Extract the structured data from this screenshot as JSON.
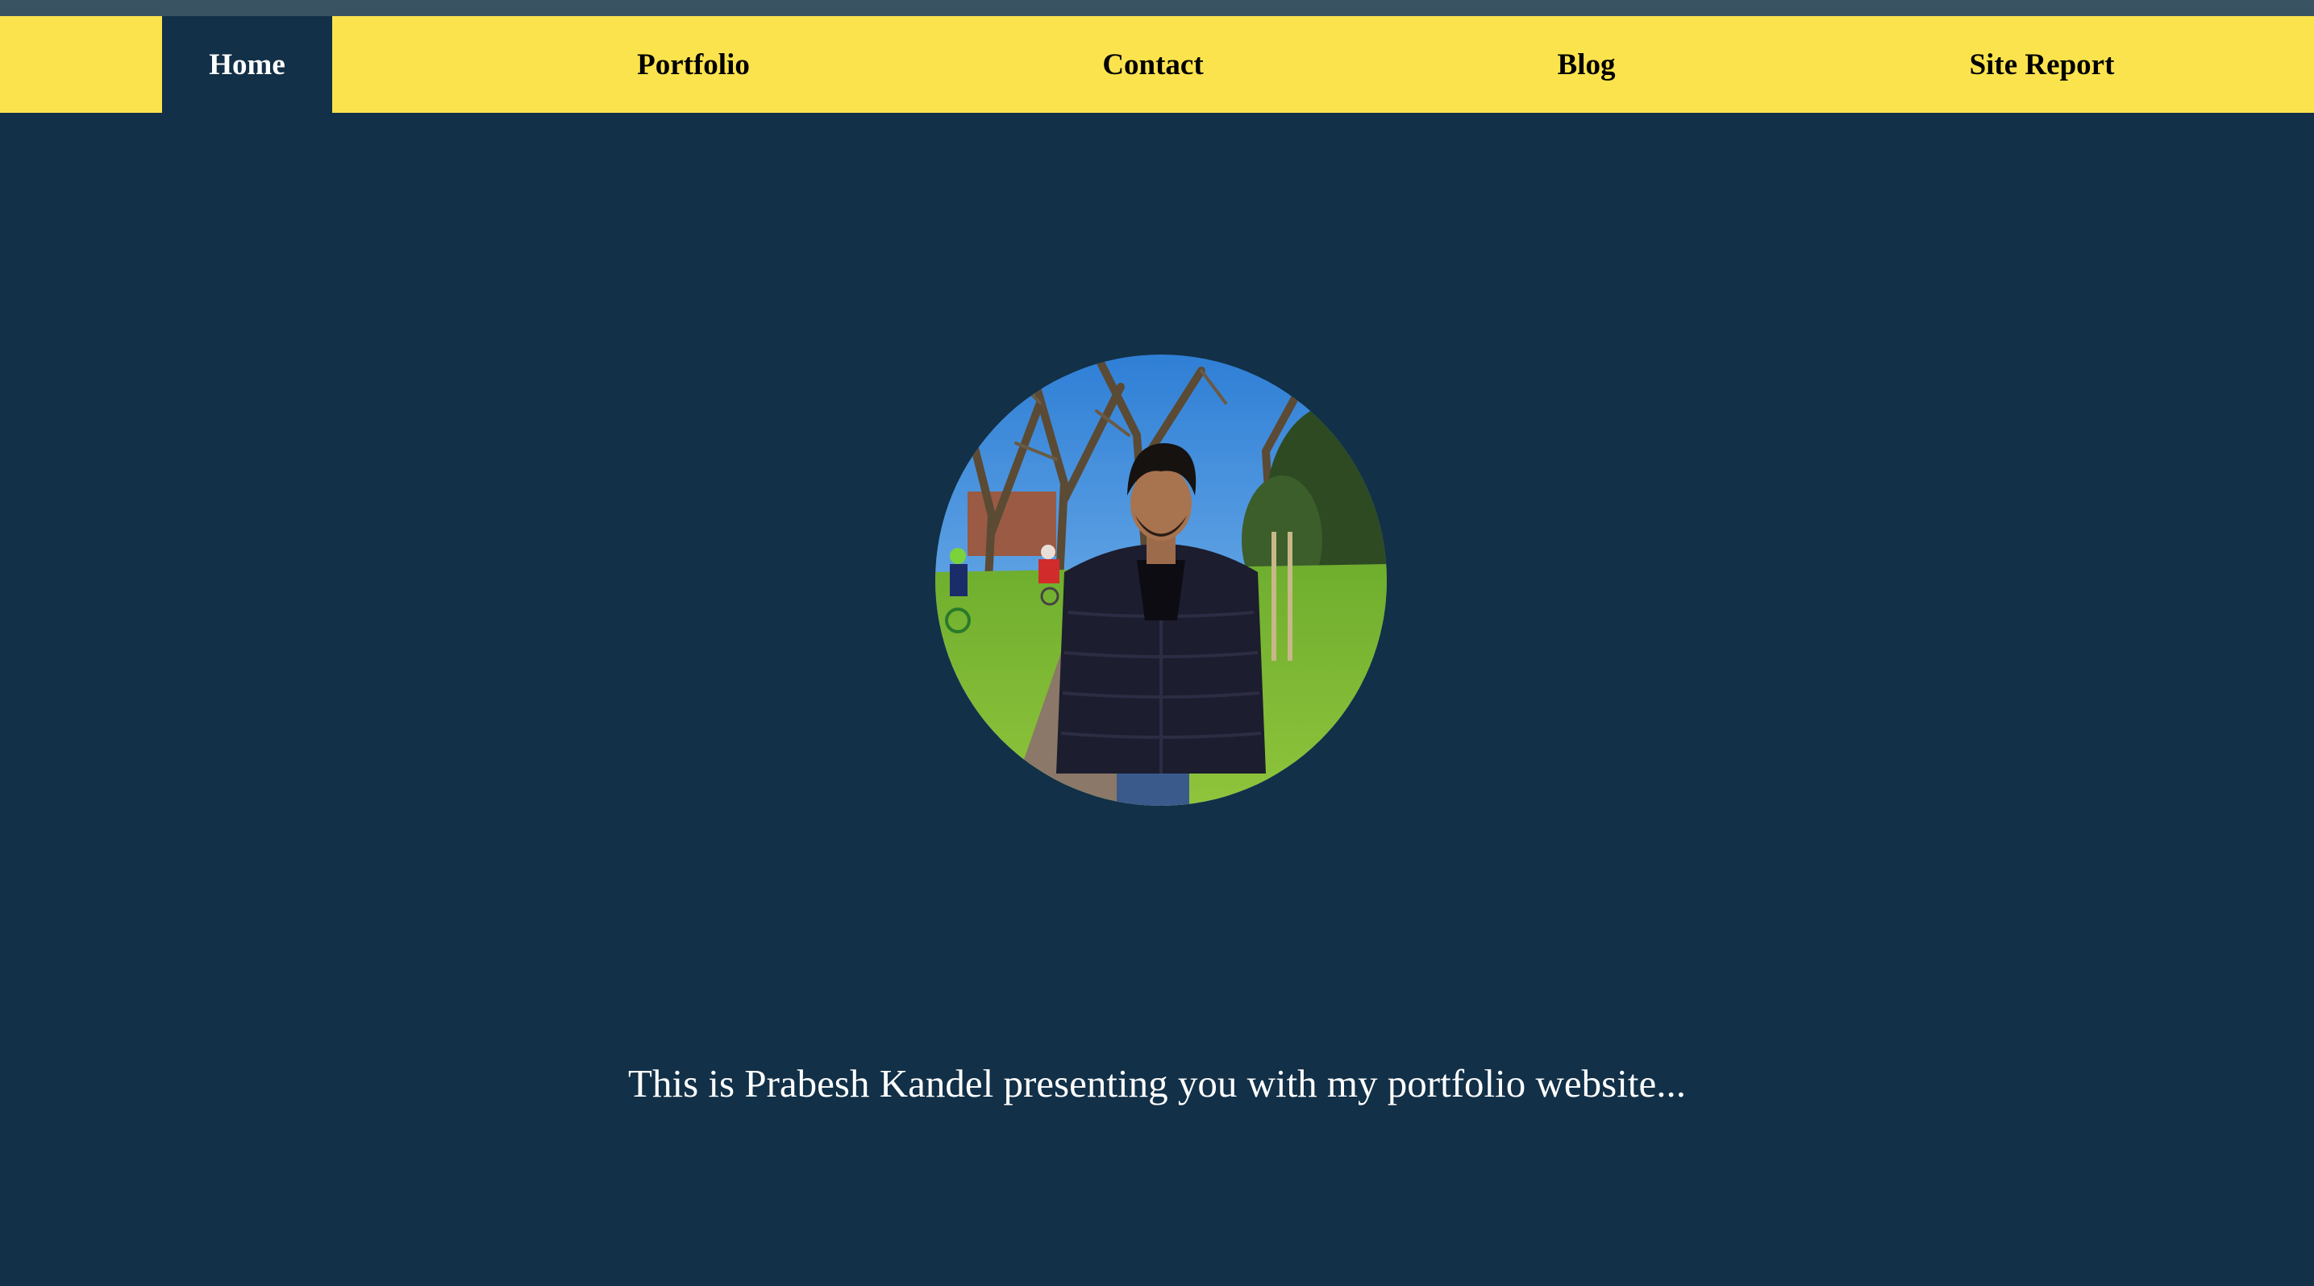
{
  "nav": {
    "items": [
      {
        "label": "Home",
        "active": true
      },
      {
        "label": "Portfolio",
        "active": false
      },
      {
        "label": "Contact",
        "active": false
      },
      {
        "label": "Blog",
        "active": false
      },
      {
        "label": "Site Report",
        "active": false
      }
    ]
  },
  "hero": {
    "intro_text": "This is Prabesh Kandel presenting you with my portfolio website..."
  },
  "colors": {
    "background": "#123047",
    "nav_background": "#fbe34e",
    "top_strip": "#3a5362",
    "active_text": "#ffffff",
    "nav_text": "#000000"
  }
}
